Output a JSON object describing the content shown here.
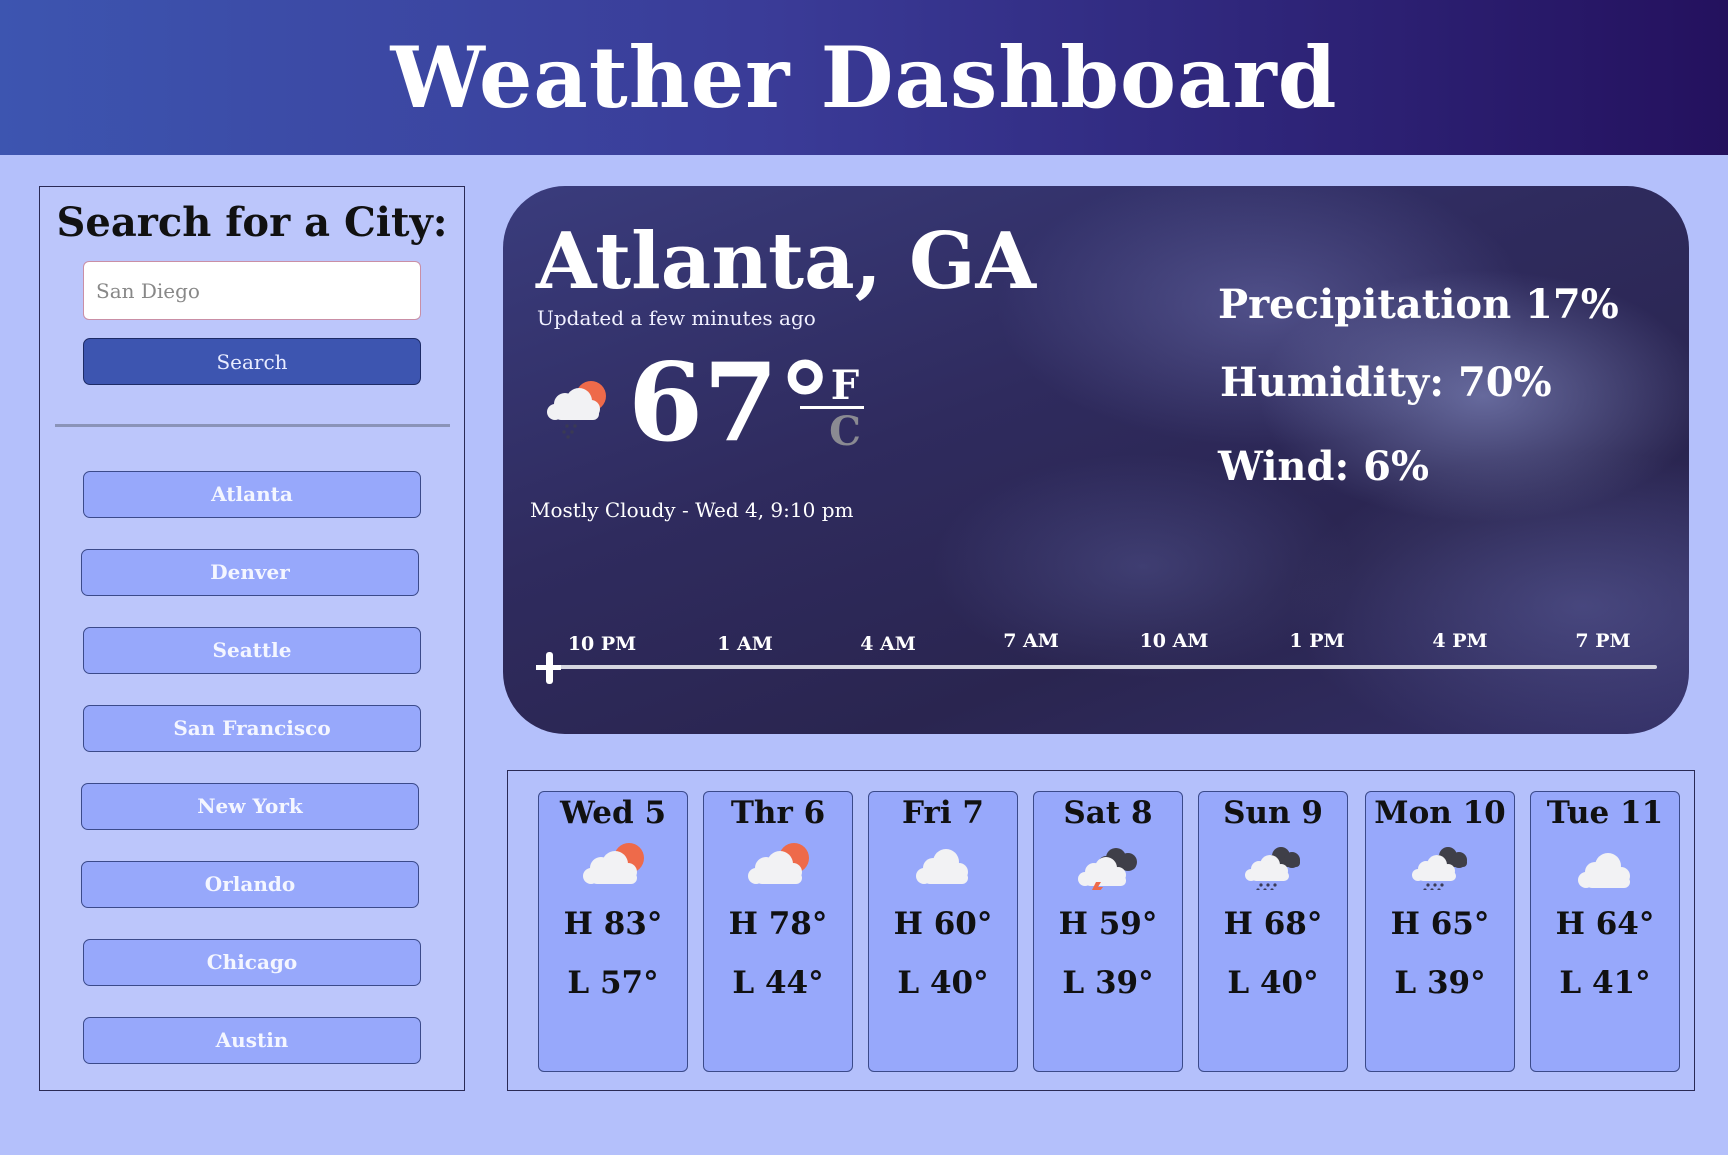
{
  "header": {
    "title": "Weather Dashboard"
  },
  "sidebar": {
    "title": "Search for a City:",
    "search": {
      "placeholder": "San Diego",
      "value": ""
    },
    "search_button": "Search",
    "cities": [
      "Atlanta",
      "Denver",
      "Seattle",
      "San Francisco",
      "New York",
      "Orlando",
      "Chicago",
      "Austin"
    ]
  },
  "current": {
    "city": "Atlanta, GA",
    "updated": "Updated a few minutes ago",
    "icon": "partly-cloudy-rain-icon",
    "temperature": "67°",
    "unit_f": "F",
    "unit_c": "C",
    "condition": "Mostly Cloudy - Wed 4, 9:10 pm",
    "precipitation": "Precipitation 17%",
    "humidity": "Humidity: 70%",
    "wind": "Wind: 6%",
    "timeline": [
      "10 PM",
      "1 AM",
      "4 AM",
      "7 AM",
      "10 AM",
      "1 PM",
      "4 PM",
      "7 PM"
    ]
  },
  "forecast": [
    {
      "day": "Wed 5",
      "icon": "partly-cloudy-icon",
      "high": "H 83°",
      "low": "L 57°"
    },
    {
      "day": "Thr 6",
      "icon": "partly-cloudy-icon",
      "high": "H 78°",
      "low": "L 44°"
    },
    {
      "day": "Fri 7",
      "icon": "cloud-icon",
      "high": "H 60°",
      "low": "L 40°"
    },
    {
      "day": "Sat 8",
      "icon": "thunderstorm-icon",
      "high": "H 59°",
      "low": "L 39°"
    },
    {
      "day": "Sun 9",
      "icon": "rain-cloud-icon",
      "high": "H 68°",
      "low": "L 40°"
    },
    {
      "day": "Mon 10",
      "icon": "rain-cloud-icon",
      "high": "H 65°",
      "low": "L 39°"
    },
    {
      "day": "Tue 11",
      "icon": "cloud-icon",
      "high": "H 64°",
      "low": "L 41°"
    }
  ],
  "colors": {
    "header_start": "#3d55b0",
    "header_end": "#24115e",
    "page_bg": "#b4c0fb",
    "button_primary": "#3d55b0",
    "city_button": "#97a8fb",
    "sun": "#ee6a4a"
  }
}
